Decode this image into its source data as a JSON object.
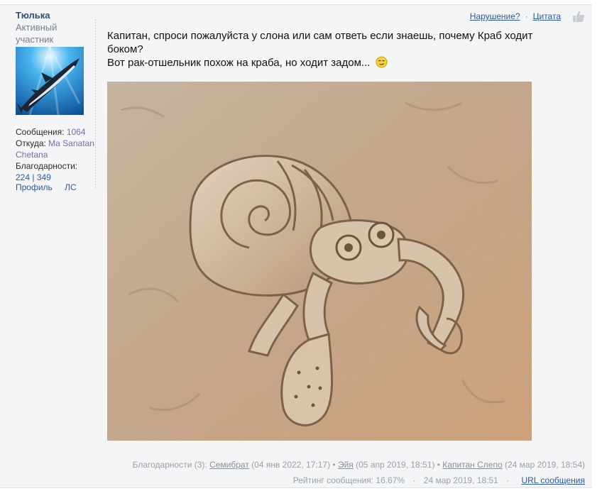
{
  "author": {
    "name": "Тюлька",
    "rank": "Активный участник",
    "stats": {
      "posts_label": "Сообщения:",
      "posts_value": "1064",
      "from_label": "Откуда:",
      "from_value": "Ma Sanatan Chetana",
      "thanks_label": "Благодарности:",
      "thanks_given": "224",
      "thanks_sep": "|",
      "thanks_received": "349"
    },
    "profile_link": "Профиль",
    "pm_link": "ЛС"
  },
  "actions": {
    "report": "Нарушение?",
    "separator": "·",
    "quote": "Цитата"
  },
  "message": {
    "line1": "Капитан, спроси пожалуйста у слона или сам ответь если знаешь, почему Краб ходит боком?",
    "line2": "Вот рак-отшельник похож на краба, но ходит задом..."
  },
  "footer": {
    "thanks_label": "Благодарности (3):",
    "thanks": [
      {
        "user": "Семибрат",
        "date": "(04 янв 2022, 17:17)"
      },
      {
        "user": "Эйя",
        "date": "(05 апр 2019, 18:51)"
      },
      {
        "user": "Капитан Слепо",
        "date": "(24 мар 2019, 18:54)"
      }
    ],
    "bullet": "•",
    "rating": "Рейтинг сообщения: 16.67%",
    "dot": "·",
    "posted": "24 мар 2019, 18:51",
    "url_link": "URL сообщения"
  },
  "icons": {
    "avatar": "shark-avatar",
    "thumb": "thumbs-up-icon",
    "emoji": "smug-emoji-icon"
  },
  "colors": {
    "background": "#f3f5f7",
    "link": "#2c5aa0",
    "author": "#2a4d7a",
    "muted": "#9aa0a6"
  }
}
